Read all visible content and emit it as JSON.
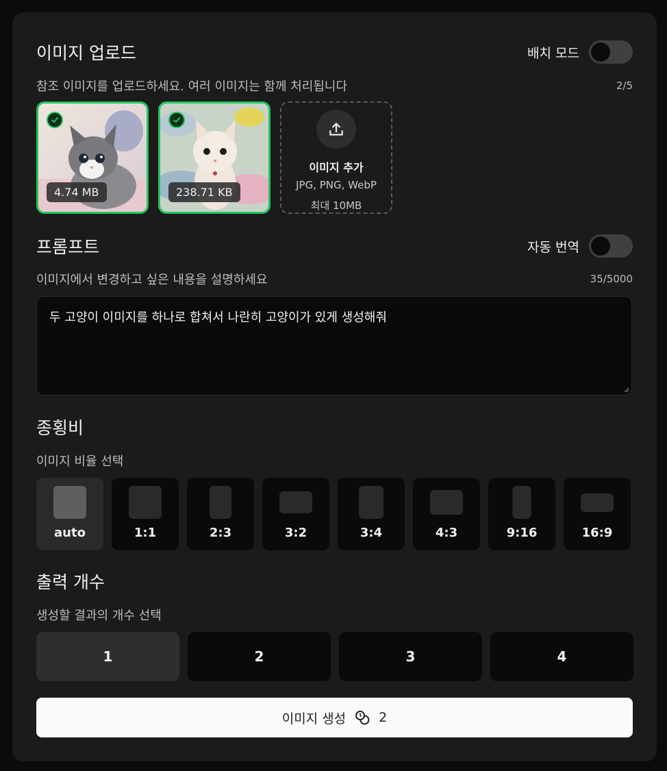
{
  "upload": {
    "title": "이미지 업로드",
    "batch_label": "배치 모드",
    "subtitle": "참조 이미지를 업로드하세요. 여러 이미지는 함께 처리됩니다",
    "counter": "2/5",
    "images": [
      {
        "size": "4.74 MB",
        "selected": true
      },
      {
        "size": "238.71 KB",
        "selected": true
      }
    ],
    "add": {
      "title": "이미지 추가",
      "formats": "JPG, PNG, WebP",
      "max": "최대 10MB"
    }
  },
  "prompt": {
    "title": "프롬프트",
    "translate_label": "자동 번역",
    "subtitle": "이미지에서 변경하고 싶은 내용을 설명하세요",
    "counter": "35/5000",
    "value": "두 고양이 이미지를 하나로 합쳐서 나란히 고양이가 있게 생성해줘"
  },
  "ratio": {
    "title": "종횡비",
    "subtitle": "이미지 비율 선택",
    "options": [
      "auto",
      "1:1",
      "2:3",
      "3:2",
      "3:4",
      "4:3",
      "9:16",
      "16:9"
    ],
    "selected": "auto"
  },
  "output": {
    "title": "출력 개수",
    "subtitle": "생성할 결과의 개수 선택",
    "options": [
      "1",
      "2",
      "3",
      "4"
    ],
    "selected": "1"
  },
  "generate": {
    "label": "이미지 생성",
    "cost": "2",
    "icon": "coins-icon"
  },
  "colors": {
    "accent_green": "#22c55e",
    "card_bg": "#1b1b1b",
    "button_bg": "#fafafa"
  }
}
